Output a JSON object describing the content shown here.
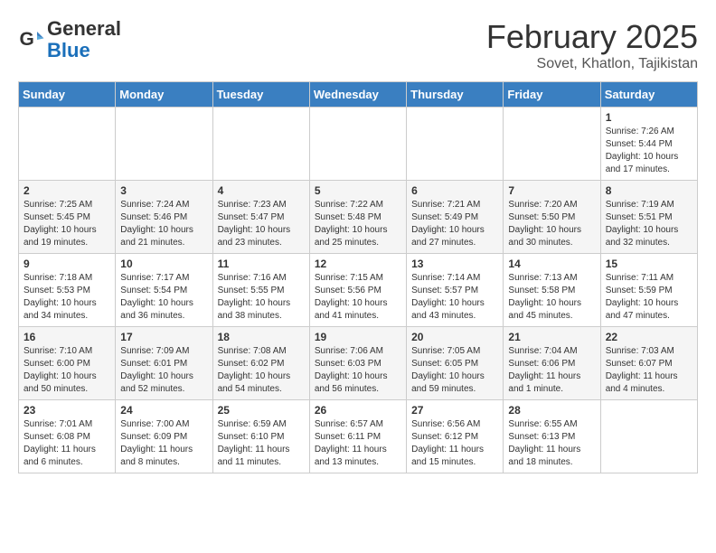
{
  "header": {
    "logo_line1": "General",
    "logo_line2": "Blue",
    "title": "February 2025",
    "location": "Sovet, Khatlon, Tajikistan"
  },
  "weekdays": [
    "Sunday",
    "Monday",
    "Tuesday",
    "Wednesday",
    "Thursday",
    "Friday",
    "Saturday"
  ],
  "weeks": [
    [
      {
        "day": "",
        "info": ""
      },
      {
        "day": "",
        "info": ""
      },
      {
        "day": "",
        "info": ""
      },
      {
        "day": "",
        "info": ""
      },
      {
        "day": "",
        "info": ""
      },
      {
        "day": "",
        "info": ""
      },
      {
        "day": "1",
        "info": "Sunrise: 7:26 AM\nSunset: 5:44 PM\nDaylight: 10 hours and 17 minutes."
      }
    ],
    [
      {
        "day": "2",
        "info": "Sunrise: 7:25 AM\nSunset: 5:45 PM\nDaylight: 10 hours and 19 minutes."
      },
      {
        "day": "3",
        "info": "Sunrise: 7:24 AM\nSunset: 5:46 PM\nDaylight: 10 hours and 21 minutes."
      },
      {
        "day": "4",
        "info": "Sunrise: 7:23 AM\nSunset: 5:47 PM\nDaylight: 10 hours and 23 minutes."
      },
      {
        "day": "5",
        "info": "Sunrise: 7:22 AM\nSunset: 5:48 PM\nDaylight: 10 hours and 25 minutes."
      },
      {
        "day": "6",
        "info": "Sunrise: 7:21 AM\nSunset: 5:49 PM\nDaylight: 10 hours and 27 minutes."
      },
      {
        "day": "7",
        "info": "Sunrise: 7:20 AM\nSunset: 5:50 PM\nDaylight: 10 hours and 30 minutes."
      },
      {
        "day": "8",
        "info": "Sunrise: 7:19 AM\nSunset: 5:51 PM\nDaylight: 10 hours and 32 minutes."
      }
    ],
    [
      {
        "day": "9",
        "info": "Sunrise: 7:18 AM\nSunset: 5:53 PM\nDaylight: 10 hours and 34 minutes."
      },
      {
        "day": "10",
        "info": "Sunrise: 7:17 AM\nSunset: 5:54 PM\nDaylight: 10 hours and 36 minutes."
      },
      {
        "day": "11",
        "info": "Sunrise: 7:16 AM\nSunset: 5:55 PM\nDaylight: 10 hours and 38 minutes."
      },
      {
        "day": "12",
        "info": "Sunrise: 7:15 AM\nSunset: 5:56 PM\nDaylight: 10 hours and 41 minutes."
      },
      {
        "day": "13",
        "info": "Sunrise: 7:14 AM\nSunset: 5:57 PM\nDaylight: 10 hours and 43 minutes."
      },
      {
        "day": "14",
        "info": "Sunrise: 7:13 AM\nSunset: 5:58 PM\nDaylight: 10 hours and 45 minutes."
      },
      {
        "day": "15",
        "info": "Sunrise: 7:11 AM\nSunset: 5:59 PM\nDaylight: 10 hours and 47 minutes."
      }
    ],
    [
      {
        "day": "16",
        "info": "Sunrise: 7:10 AM\nSunset: 6:00 PM\nDaylight: 10 hours and 50 minutes."
      },
      {
        "day": "17",
        "info": "Sunrise: 7:09 AM\nSunset: 6:01 PM\nDaylight: 10 hours and 52 minutes."
      },
      {
        "day": "18",
        "info": "Sunrise: 7:08 AM\nSunset: 6:02 PM\nDaylight: 10 hours and 54 minutes."
      },
      {
        "day": "19",
        "info": "Sunrise: 7:06 AM\nSunset: 6:03 PM\nDaylight: 10 hours and 56 minutes."
      },
      {
        "day": "20",
        "info": "Sunrise: 7:05 AM\nSunset: 6:05 PM\nDaylight: 10 hours and 59 minutes."
      },
      {
        "day": "21",
        "info": "Sunrise: 7:04 AM\nSunset: 6:06 PM\nDaylight: 11 hours and 1 minute."
      },
      {
        "day": "22",
        "info": "Sunrise: 7:03 AM\nSunset: 6:07 PM\nDaylight: 11 hours and 4 minutes."
      }
    ],
    [
      {
        "day": "23",
        "info": "Sunrise: 7:01 AM\nSunset: 6:08 PM\nDaylight: 11 hours and 6 minutes."
      },
      {
        "day": "24",
        "info": "Sunrise: 7:00 AM\nSunset: 6:09 PM\nDaylight: 11 hours and 8 minutes."
      },
      {
        "day": "25",
        "info": "Sunrise: 6:59 AM\nSunset: 6:10 PM\nDaylight: 11 hours and 11 minutes."
      },
      {
        "day": "26",
        "info": "Sunrise: 6:57 AM\nSunset: 6:11 PM\nDaylight: 11 hours and 13 minutes."
      },
      {
        "day": "27",
        "info": "Sunrise: 6:56 AM\nSunset: 6:12 PM\nDaylight: 11 hours and 15 minutes."
      },
      {
        "day": "28",
        "info": "Sunrise: 6:55 AM\nSunset: 6:13 PM\nDaylight: 11 hours and 18 minutes."
      },
      {
        "day": "",
        "info": ""
      }
    ]
  ]
}
